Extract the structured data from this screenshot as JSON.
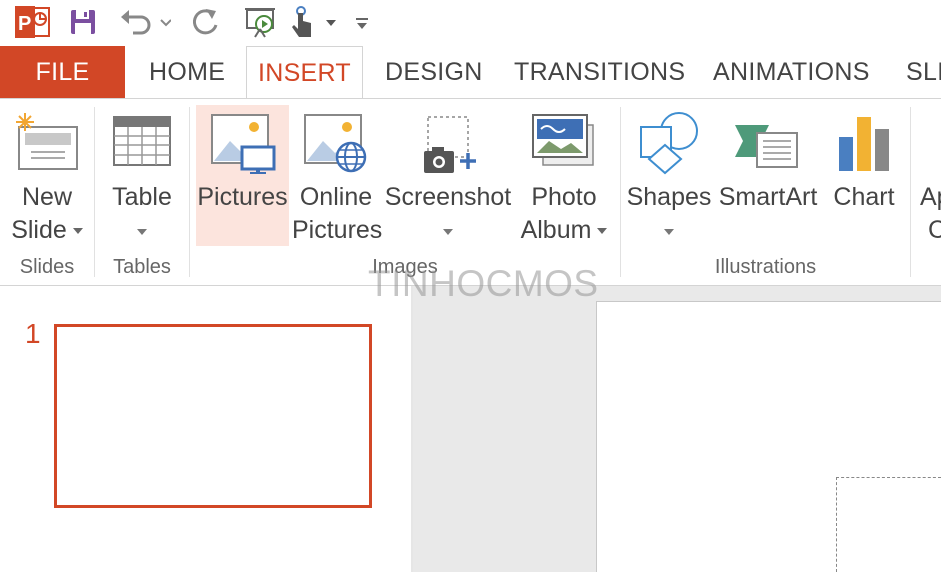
{
  "qat": {
    "icons": [
      "powerpoint-logo-icon",
      "save-icon",
      "undo-icon",
      "redo-icon",
      "start-slideshow-icon",
      "touch-mode-icon",
      "customize-qat-icon"
    ]
  },
  "tabs": [
    {
      "label": "FILE"
    },
    {
      "label": "HOME"
    },
    {
      "label": "INSERT"
    },
    {
      "label": "DESIGN"
    },
    {
      "label": "TRANSITIONS"
    },
    {
      "label": "ANIMATIONS"
    },
    {
      "label": "SLI"
    }
  ],
  "ribbon": {
    "new_slide": {
      "line1": "New",
      "line2": "Slide"
    },
    "table": {
      "line1": "Table"
    },
    "pictures": {
      "line1": "Pictures"
    },
    "online_pictures": {
      "line1": "Online",
      "line2": "Pictures"
    },
    "screenshot": {
      "line1": "Screenshot"
    },
    "photo_album": {
      "line1": "Photo",
      "line2": "Album"
    },
    "shapes": {
      "line1": "Shapes"
    },
    "smartart": {
      "line1": "SmartArt"
    },
    "chart": {
      "line1": "Chart"
    },
    "apps": {
      "line1": "Ap",
      "line2": "C"
    },
    "groups": {
      "slides": "Slides",
      "tables": "Tables",
      "images": "Images",
      "illustrations": "Illustrations"
    }
  },
  "slides_pane": {
    "slide_number": "1"
  },
  "watermark": "TINHOCMOS",
  "colors": {
    "accent": "#D24726",
    "selected_bg": "#FCE4DD"
  }
}
